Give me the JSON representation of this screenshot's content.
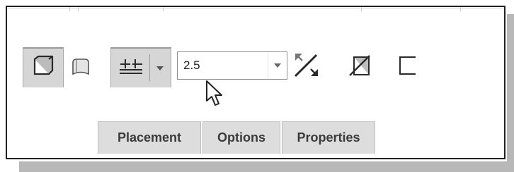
{
  "toolbar": {
    "solid_tool_icon": "solid-box-icon",
    "surface_tool_icon": "surface-icon",
    "depth_option_icon": "blind-depth-icon",
    "depth_dropdown_icon": "triangle-down-icon",
    "depth_value": "2.5",
    "depth_field_dropdown_icon": "triangle-down-icon",
    "flip_direction_icon": "flip-direction-icon",
    "remove_material_icon": "remove-material-icon",
    "thicken_icon": "thicken-sketch-icon"
  },
  "cursor": {
    "icon": "mouse-pointer-icon"
  },
  "tabs": [
    {
      "label": "Placement"
    },
    {
      "label": "Options"
    },
    {
      "label": "Properties"
    }
  ],
  "colors": {
    "pressed_background": "#d6d6d6",
    "tab_background": "#dddddd",
    "tab_text": "#3a3a3a",
    "frame_border": "#222222",
    "shadow": "#b8b8b8"
  }
}
